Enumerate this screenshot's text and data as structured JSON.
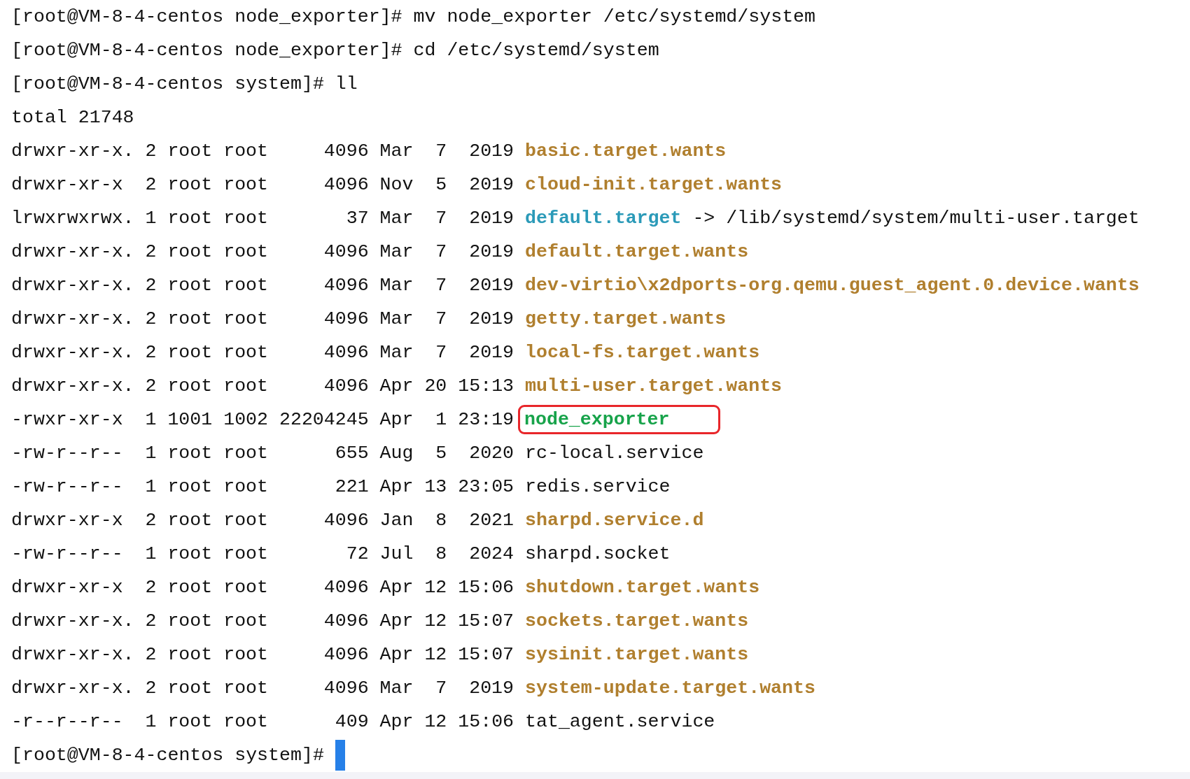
{
  "lines": [
    {
      "kind": "command",
      "prompt": "[root@VM-8-4-centos node_exporter]#",
      "command": "mv node_exporter /etc/systemd/system"
    },
    {
      "kind": "command",
      "prompt": "[root@VM-8-4-centos node_exporter]#",
      "command": "cd /etc/systemd/system"
    },
    {
      "kind": "command",
      "prompt": "[root@VM-8-4-centos system]#",
      "command": "ll"
    },
    {
      "kind": "output",
      "text": "total 21748"
    },
    {
      "kind": "dir",
      "perms": "drwxr-xr-x.",
      "links": "2",
      "owner": "root",
      "group": "root",
      "size": "4096",
      "month": "Mar",
      "day": "7",
      "time": "2019",
      "name": "basic.target.wants",
      "highlighted": false
    },
    {
      "kind": "dir",
      "perms": "drwxr-xr-x",
      "links": "2",
      "owner": "root",
      "group": "root",
      "size": "4096",
      "month": "Nov",
      "day": "5",
      "time": "2019",
      "name": "cloud-init.target.wants",
      "highlighted": false
    },
    {
      "kind": "link",
      "perms": "lrwxrwxrwx.",
      "links": "1",
      "owner": "root",
      "group": "root",
      "size": "37",
      "month": "Mar",
      "day": "7",
      "time": "2019",
      "name": "default.target",
      "arrow": "->",
      "target": "/lib/systemd/system/multi-user.target",
      "highlighted": false
    },
    {
      "kind": "dir",
      "perms": "drwxr-xr-x.",
      "links": "2",
      "owner": "root",
      "group": "root",
      "size": "4096",
      "month": "Mar",
      "day": "7",
      "time": "2019",
      "name": "default.target.wants",
      "highlighted": false
    },
    {
      "kind": "dir",
      "perms": "drwxr-xr-x.",
      "links": "2",
      "owner": "root",
      "group": "root",
      "size": "4096",
      "month": "Mar",
      "day": "7",
      "time": "2019",
      "name": "dev-virtio\\x2dports-org.qemu.guest_agent.0.device.wants",
      "highlighted": false
    },
    {
      "kind": "dir",
      "perms": "drwxr-xr-x.",
      "links": "2",
      "owner": "root",
      "group": "root",
      "size": "4096",
      "month": "Mar",
      "day": "7",
      "time": "2019",
      "name": "getty.target.wants",
      "highlighted": false
    },
    {
      "kind": "dir",
      "perms": "drwxr-xr-x.",
      "links": "2",
      "owner": "root",
      "group": "root",
      "size": "4096",
      "month": "Mar",
      "day": "7",
      "time": "2019",
      "name": "local-fs.target.wants",
      "highlighted": false
    },
    {
      "kind": "dir",
      "perms": "drwxr-xr-x.",
      "links": "2",
      "owner": "root",
      "group": "root",
      "size": "4096",
      "month": "Apr",
      "day": "20",
      "time": "15:13",
      "name": "multi-user.target.wants",
      "highlighted": false
    },
    {
      "kind": "exec",
      "perms": "-rwxr-xr-x",
      "links": "1",
      "owner": "1001",
      "group": "1002",
      "size": "22204245",
      "month": "Apr",
      "day": "1",
      "time": "23:19",
      "name": "node_exporter",
      "highlighted": true
    },
    {
      "kind": "file",
      "perms": "-rw-r--r--",
      "links": "1",
      "owner": "root",
      "group": "root",
      "size": "655",
      "month": "Aug",
      "day": "5",
      "time": "2020",
      "name": "rc-local.service",
      "highlighted": false
    },
    {
      "kind": "file",
      "perms": "-rw-r--r--",
      "links": "1",
      "owner": "root",
      "group": "root",
      "size": "221",
      "month": "Apr",
      "day": "13",
      "time": "23:05",
      "name": "redis.service",
      "highlighted": false
    },
    {
      "kind": "dir",
      "perms": "drwxr-xr-x",
      "links": "2",
      "owner": "root",
      "group": "root",
      "size": "4096",
      "month": "Jan",
      "day": "8",
      "time": "2021",
      "name": "sharpd.service.d",
      "highlighted": false
    },
    {
      "kind": "file",
      "perms": "-rw-r--r--",
      "links": "1",
      "owner": "root",
      "group": "root",
      "size": "72",
      "month": "Jul",
      "day": "8",
      "time": "2024",
      "name": "sharpd.socket",
      "highlighted": false
    },
    {
      "kind": "dir",
      "perms": "drwxr-xr-x",
      "links": "2",
      "owner": "root",
      "group": "root",
      "size": "4096",
      "month": "Apr",
      "day": "12",
      "time": "15:06",
      "name": "shutdown.target.wants",
      "highlighted": false
    },
    {
      "kind": "dir",
      "perms": "drwxr-xr-x.",
      "links": "2",
      "owner": "root",
      "group": "root",
      "size": "4096",
      "month": "Apr",
      "day": "12",
      "time": "15:07",
      "name": "sockets.target.wants",
      "highlighted": false
    },
    {
      "kind": "dir",
      "perms": "drwxr-xr-x.",
      "links": "2",
      "owner": "root",
      "group": "root",
      "size": "4096",
      "month": "Apr",
      "day": "12",
      "time": "15:07",
      "name": "sysinit.target.wants",
      "highlighted": false
    },
    {
      "kind": "dir",
      "perms": "drwxr-xr-x.",
      "links": "2",
      "owner": "root",
      "group": "root",
      "size": "4096",
      "month": "Mar",
      "day": "7",
      "time": "2019",
      "name": "system-update.target.wants",
      "highlighted": false
    },
    {
      "kind": "file",
      "perms": "-r--r--r--",
      "links": "1",
      "owner": "root",
      "group": "root",
      "size": "409",
      "month": "Apr",
      "day": "12",
      "time": "15:06",
      "name": "tat_agent.service",
      "highlighted": false
    },
    {
      "kind": "prompt",
      "prompt": "[root@VM-8-4-centos system]#",
      "cursor": true
    }
  ]
}
